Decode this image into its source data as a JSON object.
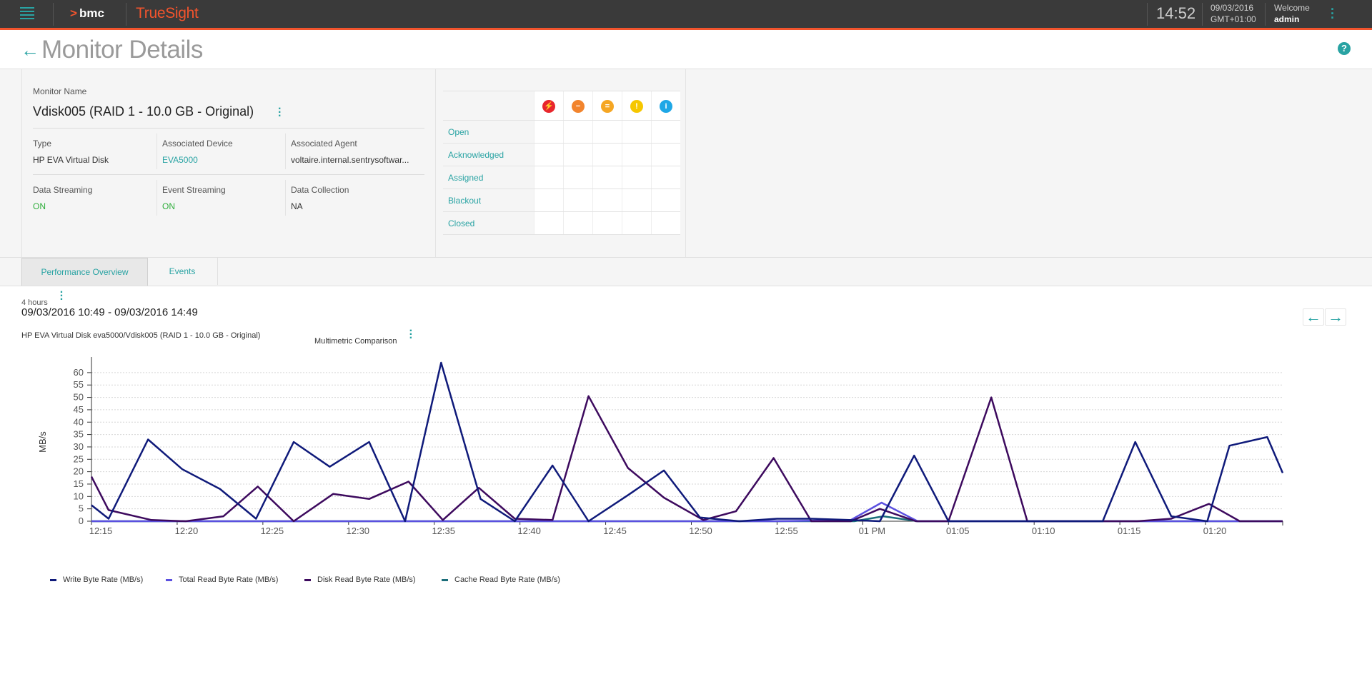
{
  "topbar": {
    "brand": "bmc",
    "product": "TrueSight",
    "time": "14:52",
    "date": "09/03/2016",
    "timezone": "GMT+01:00",
    "welcome_label": "Welcome",
    "user": "admin"
  },
  "page": {
    "title": "Monitor Details"
  },
  "monitor": {
    "name_label": "Monitor Name",
    "name": "Vdisk005 (RAID 1 - 10.0 GB - Original)",
    "type_label": "Type",
    "type": "HP EVA Virtual Disk",
    "device_label": "Associated Device",
    "device": "EVA5000",
    "agent_label": "Associated Agent",
    "agent": "voltaire.internal.sentrysoftwar...",
    "data_streaming_label": "Data Streaming",
    "data_streaming": "ON",
    "event_streaming_label": "Event Streaming",
    "event_streaming": "ON",
    "data_collection_label": "Data Collection",
    "data_collection": "NA"
  },
  "events_table": {
    "severity_icons": [
      {
        "name": "critical-icon",
        "color": "#e8262d",
        "glyph": "⚡"
      },
      {
        "name": "major-icon",
        "color": "#f2842d",
        "glyph": "−"
      },
      {
        "name": "minor-icon",
        "color": "#f5a623",
        "glyph": "="
      },
      {
        "name": "warning-icon",
        "color": "#f6c700",
        "glyph": "!"
      },
      {
        "name": "info-icon",
        "color": "#1ea7e6",
        "glyph": "i"
      }
    ],
    "rows": [
      "Open",
      "Acknowledged",
      "Assigned",
      "Blackout",
      "Closed"
    ]
  },
  "tabs": {
    "performance": "Performance Overview",
    "events": "Events"
  },
  "chart_header": {
    "range": "4 hours",
    "dates": "09/03/2016 10:49 - 09/03/2016 14:49",
    "subtitle": "HP EVA Virtual Disk eva5000/Vdisk005 (RAID 1 - 10.0 GB - Original)",
    "mode": "Multimetric Comparison"
  },
  "chart_data": {
    "type": "line",
    "ylabel": "MB/s",
    "xlabel": "",
    "ylim": [
      0,
      64
    ],
    "yticks": [
      0,
      5,
      10,
      15,
      20,
      25,
      30,
      35,
      40,
      45,
      50,
      55,
      60
    ],
    "xlim": [
      0,
      69.5
    ],
    "xticks": [
      {
        "t": 0,
        "label": "12:15"
      },
      {
        "t": 5,
        "label": "12:20"
      },
      {
        "t": 10,
        "label": "12:25"
      },
      {
        "t": 15,
        "label": "12:30"
      },
      {
        "t": 20,
        "label": "12:35"
      },
      {
        "t": 25,
        "label": "12:40"
      },
      {
        "t": 30,
        "label": "12:45"
      },
      {
        "t": 35,
        "label": "12:50"
      },
      {
        "t": 40,
        "label": "12:55"
      },
      {
        "t": 45,
        "label": "01 PM"
      },
      {
        "t": 50,
        "label": "01:05"
      },
      {
        "t": 55,
        "label": "01:10"
      },
      {
        "t": 60,
        "label": "01:15"
      },
      {
        "t": 65,
        "label": "01:20"
      }
    ],
    "grid": true,
    "legend": "bottom-left",
    "series": [
      {
        "name": "Write Byte Rate (MB/s)",
        "color": "#0f1a7a",
        "points": [
          [
            0,
            6.5
          ],
          [
            1,
            1
          ],
          [
            3.3,
            33
          ],
          [
            5.3,
            21
          ],
          [
            7.5,
            13
          ],
          [
            9.6,
            1
          ],
          [
            11.8,
            32
          ],
          [
            13.9,
            22
          ],
          [
            16.2,
            32
          ],
          [
            18.3,
            0
          ],
          [
            20.4,
            64
          ],
          [
            22.7,
            9
          ],
          [
            24.7,
            0
          ],
          [
            26.9,
            22.5
          ],
          [
            29,
            0
          ],
          [
            31.3,
            10.5
          ],
          [
            33.4,
            20.5
          ],
          [
            35.5,
            1.5
          ],
          [
            37.8,
            0
          ],
          [
            40,
            1
          ],
          [
            42,
            1
          ],
          [
            44.2,
            0.5
          ],
          [
            46,
            0
          ],
          [
            48,
            26.5
          ],
          [
            50,
            0
          ],
          [
            52,
            0
          ],
          [
            55,
            0
          ],
          [
            57,
            0
          ],
          [
            59,
            0
          ],
          [
            60.9,
            32
          ],
          [
            63,
            2
          ],
          [
            65.1,
            0
          ],
          [
            66.4,
            30.5
          ],
          [
            68.6,
            34
          ],
          [
            69.5,
            19.5
          ]
        ]
      },
      {
        "name": "Total Read Byte Rate (MB/s)",
        "color": "#5b50e0",
        "points": [
          [
            0,
            0
          ],
          [
            20,
            0
          ],
          [
            40,
            0
          ],
          [
            44.3,
            0.5
          ],
          [
            46.1,
            7.5
          ],
          [
            48.2,
            0
          ],
          [
            69.5,
            0
          ]
        ]
      },
      {
        "name": "Disk Read Byte Rate (MB/s)",
        "color": "#3d0a5e",
        "points": [
          [
            0,
            18
          ],
          [
            1,
            4.5
          ],
          [
            3.5,
            0.5
          ],
          [
            5.5,
            0
          ],
          [
            7.7,
            2
          ],
          [
            9.7,
            14
          ],
          [
            11.8,
            0
          ],
          [
            14.1,
            11
          ],
          [
            16.2,
            9
          ],
          [
            18.5,
            16
          ],
          [
            20.5,
            0.5
          ],
          [
            22.6,
            13.5
          ],
          [
            24.7,
            1
          ],
          [
            26.9,
            0.5
          ],
          [
            29,
            50.5
          ],
          [
            31.3,
            21.5
          ],
          [
            33.4,
            9.5
          ],
          [
            35.7,
            0.5
          ],
          [
            37.6,
            4
          ],
          [
            39.8,
            25.5
          ],
          [
            42,
            0
          ],
          [
            44.3,
            0
          ],
          [
            46,
            5
          ],
          [
            48.1,
            0
          ],
          [
            50,
            0
          ],
          [
            52.5,
            50
          ],
          [
            54.6,
            0
          ],
          [
            56.7,
            0
          ],
          [
            58.8,
            0
          ],
          [
            61,
            0
          ],
          [
            63,
            1
          ],
          [
            65.2,
            7
          ],
          [
            67,
            0
          ],
          [
            69.5,
            0
          ]
        ]
      },
      {
        "name": "Cache Read Byte Rate (MB/s)",
        "color": "#1b6e7a",
        "points": [
          [
            0,
            0
          ],
          [
            20,
            0
          ],
          [
            40,
            0
          ],
          [
            44.5,
            0
          ],
          [
            46.2,
            2
          ],
          [
            48.2,
            0
          ],
          [
            69.5,
            0
          ]
        ]
      }
    ]
  }
}
